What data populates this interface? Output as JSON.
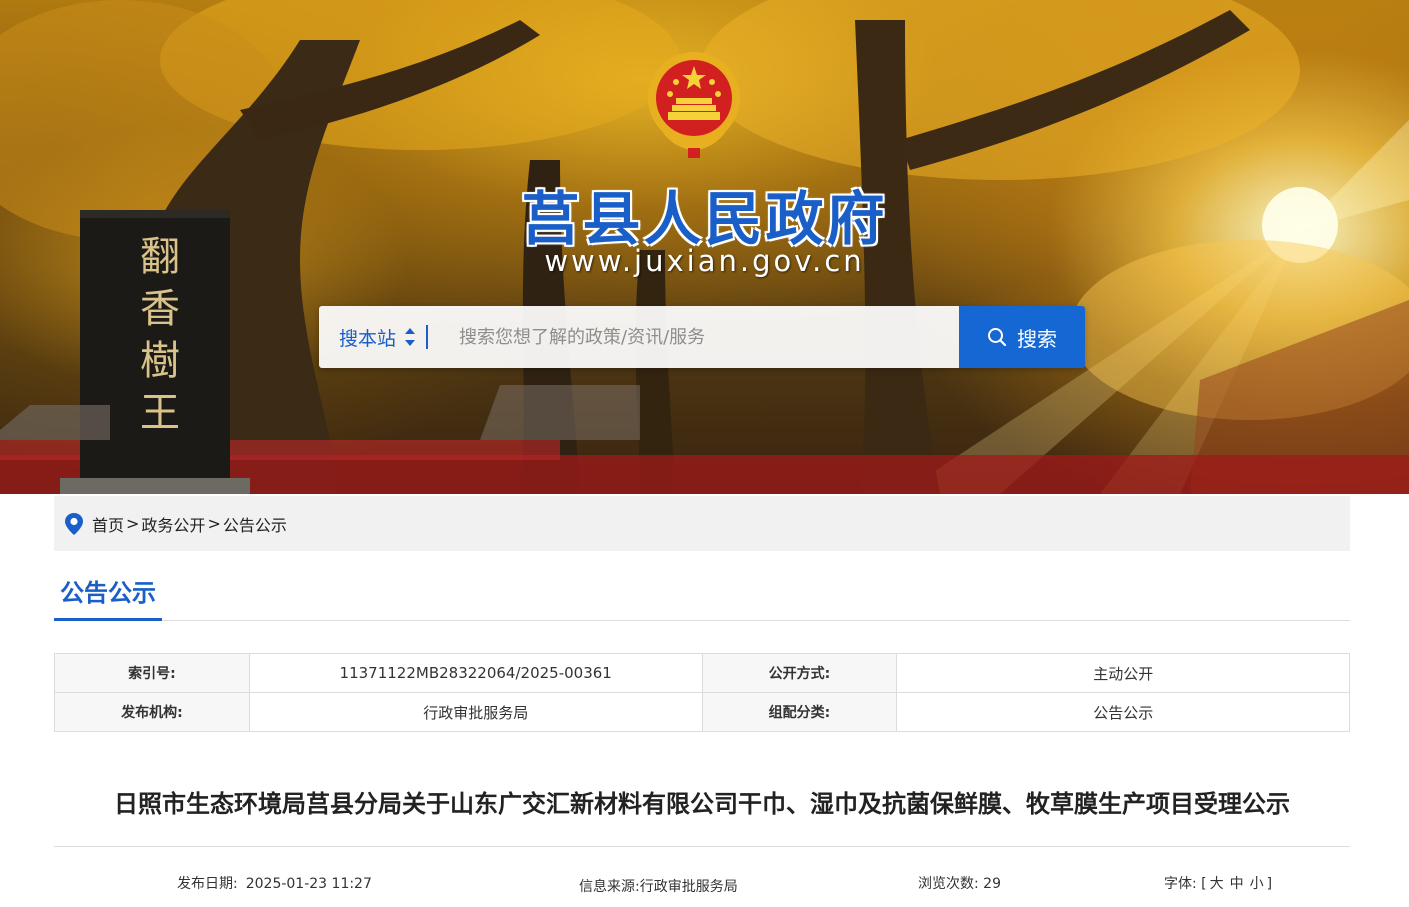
{
  "header": {
    "site_title": "莒县人民政府",
    "site_url": "www.juxian.gov.cn",
    "emblem_icon": "national-emblem-icon"
  },
  "search": {
    "scope_label": "搜本站",
    "placeholder": "搜索您想了解的政策/资讯/服务",
    "button_label": "搜索",
    "button_color": "#1567d3"
  },
  "breadcrumb": {
    "items": [
      "首页",
      "政务公开",
      "公告公示"
    ],
    "separator": ">"
  },
  "section": {
    "tab_label": "公告公示",
    "accent": "#1a5fc8"
  },
  "meta": {
    "index_label": "索引号:",
    "index_value": "11371122MB28322064/2025-00361",
    "open_mode_label": "公开方式:",
    "open_mode_value": "主动公开",
    "publisher_label": "发布机构:",
    "publisher_value": "行政审批服务局",
    "category_label": "组配分类:",
    "category_value": "公告公示"
  },
  "article": {
    "title": "日照市生态环境局莒县分局关于山东广交汇新材料有限公司干巾、湿巾及抗菌保鲜膜、牧草膜生产项目受理公示",
    "date_label": "发布日期:",
    "date_value": "2025-01-23 11:27",
    "source_label": "信息来源:",
    "source_value": "行政审批服务局",
    "views_label": "浏览次数:",
    "views_value": "29",
    "font_label": "字体:",
    "font_open": "[",
    "font_large": "大",
    "font_medium": "中",
    "font_small": "小",
    "font_close": "]"
  }
}
